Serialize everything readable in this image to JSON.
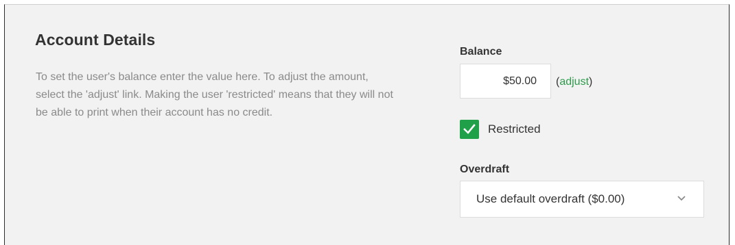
{
  "section": {
    "title": "Account Details",
    "description": "To set the user's balance enter the value here. To adjust the amount, select the 'adjust' link. Making the user 'restricted' means that they will not be able to print when their account has no credit."
  },
  "balance": {
    "label": "Balance",
    "value": "$50.00",
    "adjust_open": "(",
    "adjust_link": "adjust",
    "adjust_close": ")"
  },
  "restricted": {
    "label": "Restricted",
    "checked": true
  },
  "overdraft": {
    "label": "Overdraft",
    "selected": "Use default overdraft ($0.00)"
  },
  "colors": {
    "accent": "#21a04a",
    "link": "#2e9a4a",
    "panel_bg": "#f2f2f2"
  }
}
